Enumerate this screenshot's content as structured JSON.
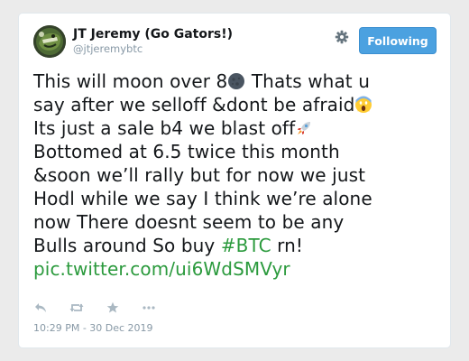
{
  "tweet": {
    "author": {
      "display_name": "JT Jeremy (Go Gators!)",
      "handle": "@jtjeremybtc",
      "avatar_icon": "gator-avatar"
    },
    "follow_button_label": "Following",
    "settings_icon": "gear-icon",
    "text_lines": [
      "This will moon over 8",
      " Thats what u",
      "say after we selloff &dont be afraid",
      "Its just a sale b4 we blast off",
      "Bottomed at 6.5 twice this month",
      "&soon we’ll rally but for now we just",
      "Hodl while we say I think we’re alone",
      "now There doesnt seem to be any",
      "Bulls around So buy ",
      "#BTC",
      " rn!",
      "pic.twitter.com/ui6WdSMVyr"
    ],
    "emojis": {
      "moon": "new-moon-face-emoji",
      "scream": "screaming-face-emoji",
      "rocket": "rocket-emoji"
    },
    "actions": [
      "reply-icon",
      "retweet-icon",
      "like-icon",
      "more-icon"
    ],
    "timestamp": "10:29 PM - 30 Dec 2019",
    "colors": {
      "link": "#2b9a3d",
      "follow_button": "#4ba1e0",
      "muted": "#8899a6"
    }
  }
}
